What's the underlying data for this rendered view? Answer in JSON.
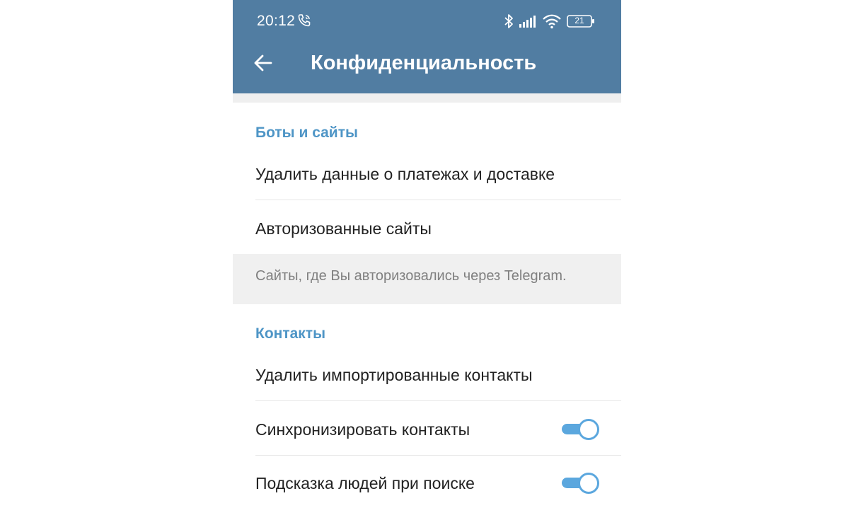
{
  "status_bar": {
    "time": "20:12",
    "battery": "21"
  },
  "header": {
    "title": "Конфиденциальность"
  },
  "bots_section": {
    "title": "Боты и сайты",
    "items": [
      {
        "label": "Удалить данные о платежах и доставке"
      },
      {
        "label": "Авторизованные сайты"
      }
    ],
    "info": "Сайты, где Вы авторизовались через Telegram."
  },
  "contacts_section": {
    "title": "Контакты",
    "items": [
      {
        "label": "Удалить импортированные контакты"
      },
      {
        "label": "Синхронизировать контакты",
        "toggle": "on"
      },
      {
        "label": "Подсказка людей при поиске",
        "toggle": "on"
      }
    ]
  },
  "colors": {
    "header_bg": "#517da2",
    "section_title": "#4e95c6",
    "toggle_on": "#5ba7de"
  }
}
